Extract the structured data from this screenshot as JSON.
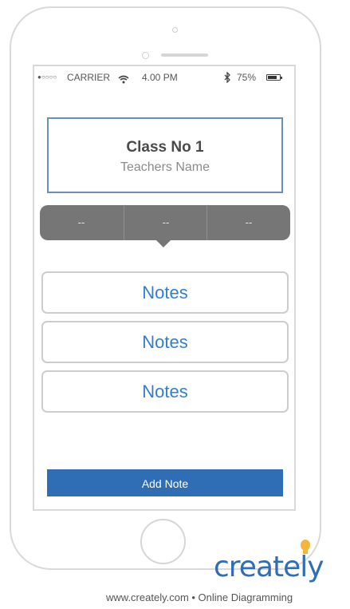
{
  "status_bar": {
    "signal": "●○○○○",
    "carrier": "CARRIER",
    "wifi_icon": "wifi-icon",
    "time": "4.00 PM",
    "bluetooth_icon": "bluetooth-icon",
    "battery_percent": "75%",
    "battery_level": 0.75
  },
  "class_card": {
    "title": "Class No 1",
    "teacher": "Teachers Name"
  },
  "segments": [
    "--",
    "--",
    "--"
  ],
  "notes": [
    "Notes",
    "Notes",
    "Notes"
  ],
  "add_note_label": "Add Note",
  "branding": {
    "logo": "creately",
    "tagline": "www.creately.com • Online Diagramming"
  },
  "colors": {
    "accent_blue": "#2f6db5",
    "note_text": "#2f7fd1",
    "segment_bg": "#767676",
    "card_border": "#6a8fbd"
  }
}
